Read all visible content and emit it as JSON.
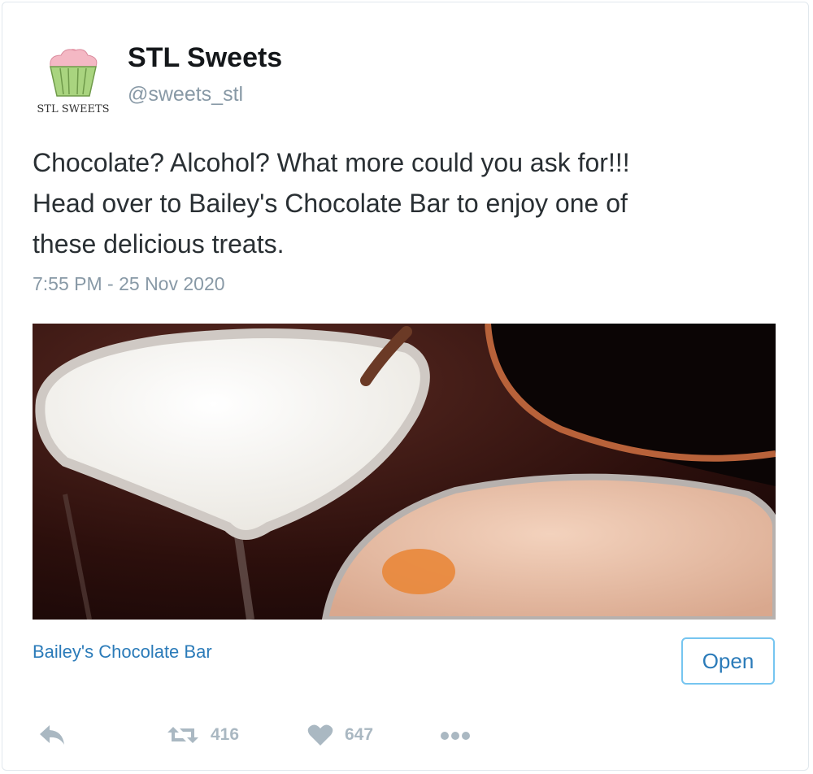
{
  "account": {
    "name": "STL Sweets",
    "handle": "@sweets_stl",
    "avatar_text": "STL SWEETS"
  },
  "tweet": {
    "lines": [
      "Chocolate? Alcohol? What more could you ask for!!!",
      "Head over to Bailey's Chocolate Bar to enjoy one of",
      "these delicious treats."
    ],
    "timestamp": "7:55 PM - 25 Nov 2020"
  },
  "media": {
    "description_icon": "cocktail-photo"
  },
  "link_card": {
    "title": "Bailey's Chocolate Bar",
    "open_label": "Open"
  },
  "actions": {
    "reply_icon": "reply-icon",
    "retweet_count": "416",
    "like_count": "647",
    "more_icon": "more-icon"
  },
  "colors": {
    "link": "#2b7bb9",
    "muted": "#8899a6",
    "button_border": "#76c5f0",
    "icon": "#aab8c2"
  }
}
